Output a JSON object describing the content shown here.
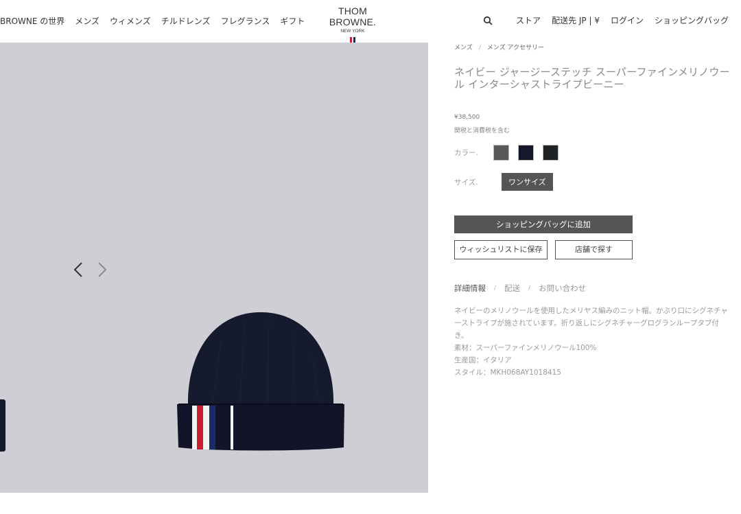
{
  "header": {
    "nav_left": [
      "BROWNE の世界",
      "メンズ",
      "ウィメンズ",
      "チルドレンズ",
      "フレグランス",
      "ギフト"
    ],
    "brand_name": "THOM BROWNE.",
    "brand_sub": "NEW YORK",
    "nav_right": {
      "store": "ストア",
      "shipping": "配送先 JP | ¥",
      "login": "ログイン",
      "bag": "ショッピングバッグ"
    },
    "icons": {
      "search": "search-icon"
    }
  },
  "breadcrumb": [
    "メンズ",
    "メンズ アクセサリー"
  ],
  "product": {
    "title": "ネイビー ジャージーステッチ スーパーファインメリノウール インターシャストライプビーニー",
    "price": "¥38,500",
    "tax_note": "関税と消費税を含む",
    "color_label": "カラー.",
    "colors": [
      "#58585a",
      "#15172b",
      "#1f2326"
    ],
    "size_label": "サイズ.",
    "size_value": "ワンサイズ",
    "add_to_bag": "ショッピングバッグに追加",
    "wishlist": "ウィッシュリストに保存",
    "find_in_store": "店舗で探す"
  },
  "tabs": [
    "詳細情報",
    "配送",
    "お問い合わせ"
  ],
  "description": {
    "text": "ネイビーのメリノウールを使用したメリヤス編みのニット帽。かぶり口にシグネチャーストライプが施されています。折り返しにシグネチャーグログランループタブ付き。",
    "material": "素材：スーパーファインメリノウール100%",
    "origin": "生産国：イタリア",
    "style": "スタイル：MKH068AY1018415"
  },
  "colors": {
    "gallery_bg": "#cfced4",
    "beanie_navy": "#161a2e",
    "stripe_red": "#c8202f",
    "stripe_white": "#f2f2f2",
    "button_dark": "#555555"
  }
}
